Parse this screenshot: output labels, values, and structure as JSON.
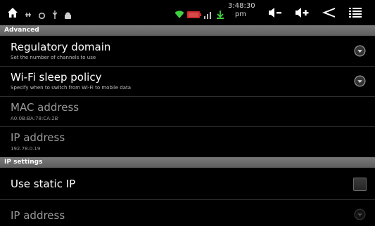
{
  "status_bar": {
    "time": "3:48:30 pm",
    "left_icons": [
      "home-icon",
      "usb-icon",
      "sync-icon",
      "usb-debug-icon",
      "android-icon"
    ],
    "center_icons": [
      "wifi-icon",
      "battery-icon",
      "signal-icon",
      "download-icon"
    ],
    "right_buttons": [
      "volume-down-icon",
      "volume-up-icon",
      "back-icon",
      "menu-icon"
    ]
  },
  "sections": {
    "advanced": "Advanced",
    "ip_settings": "IP settings"
  },
  "prefs": {
    "regulatory_domain": {
      "title": "Regulatory domain",
      "summary": "Set the number of channels to use"
    },
    "wifi_sleep_policy": {
      "title": "Wi-Fi sleep policy",
      "summary": "Specify when to switch from Wi-Fi to mobile data"
    },
    "mac_address": {
      "title": "MAC address",
      "summary": "A0:0B:BA:78:CA:2B"
    },
    "ip_address": {
      "title": "IP address",
      "summary": "192.78.0.19"
    },
    "use_static_ip": {
      "title": "Use static IP",
      "checked": false
    },
    "static_ip_address": {
      "title": "IP address"
    }
  },
  "colors": {
    "section_header": "#6b6b6b",
    "background": "#000000",
    "wifi": "#3fd13f",
    "battery": "#cc2a2a"
  }
}
